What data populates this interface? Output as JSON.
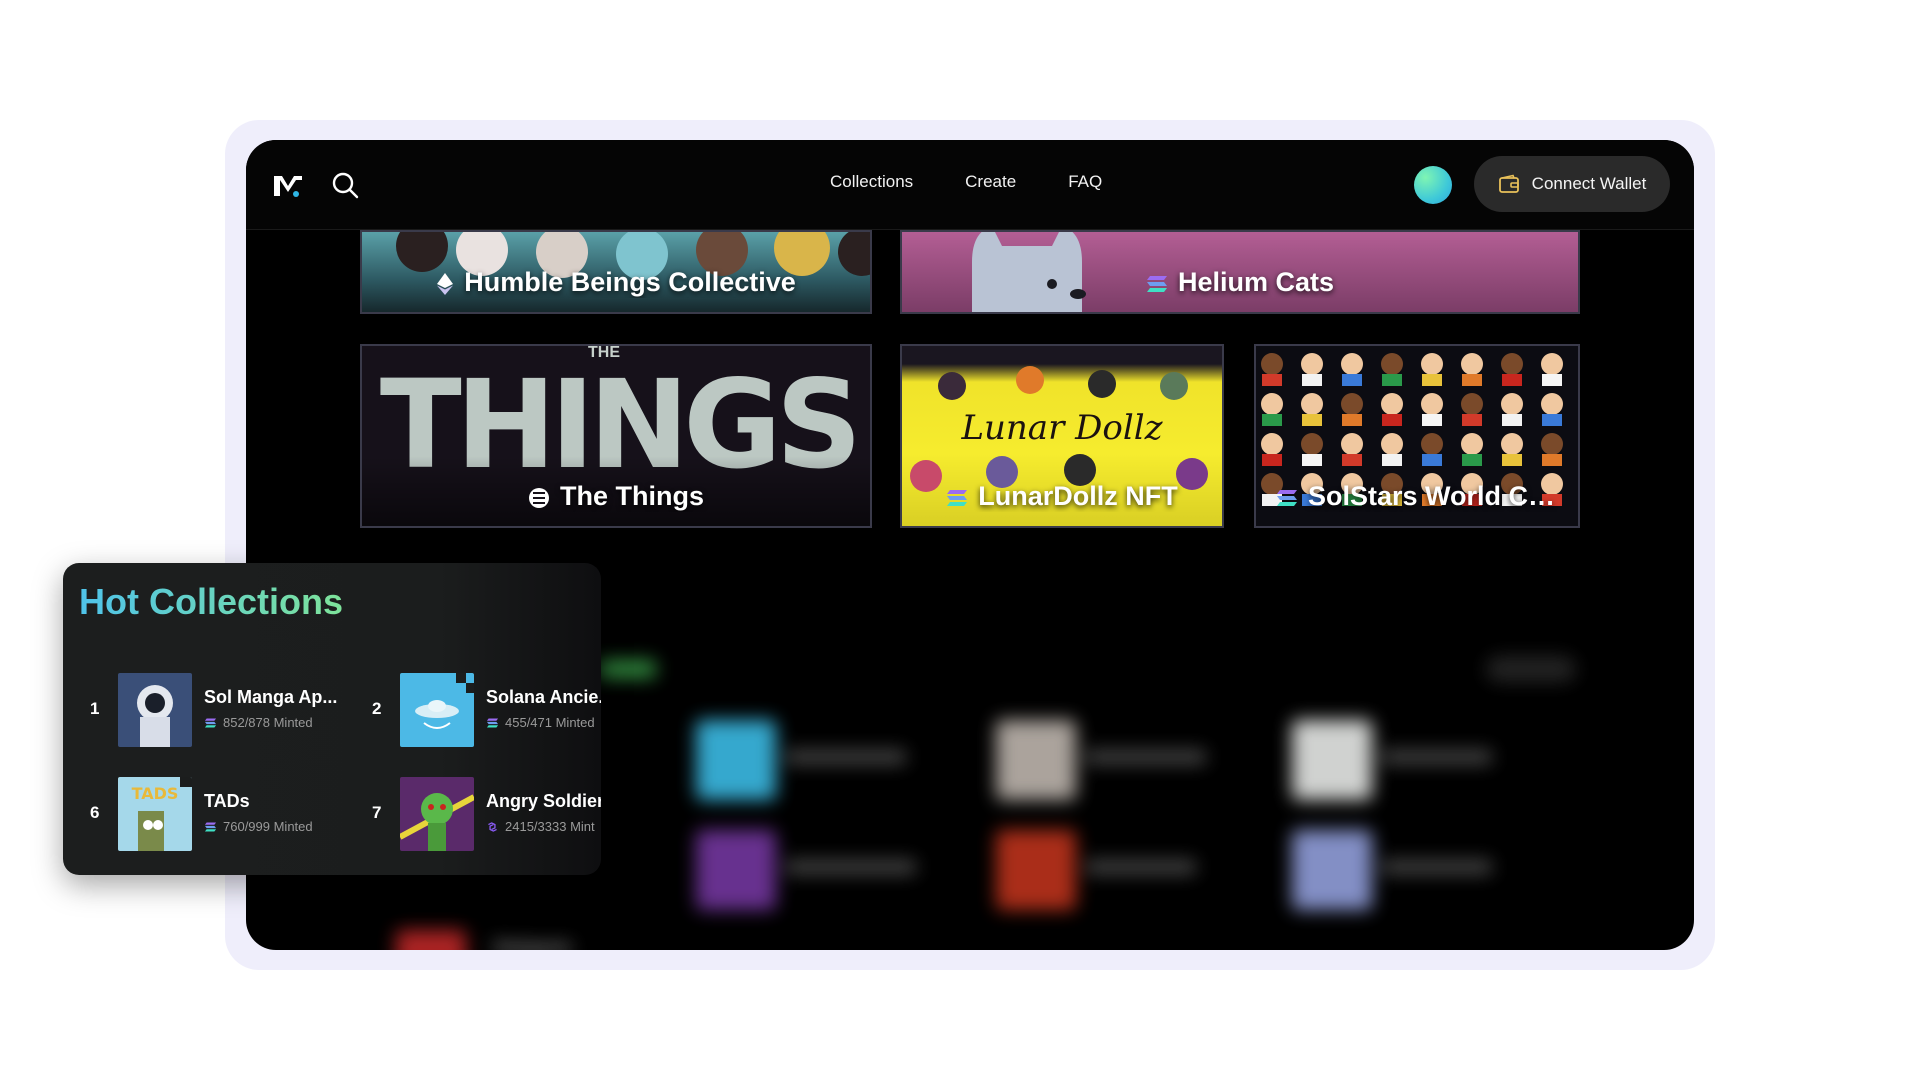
{
  "header": {
    "logo_icon": "magic-eden-logo-icon",
    "search_icon": "search-icon",
    "nav": [
      "Collections",
      "Create",
      "FAQ"
    ],
    "connect_wallet_label": "Connect Wallet",
    "wallet_icon": "wallet-icon"
  },
  "featured": {
    "row1": [
      {
        "name": "Humble Beings Collective",
        "chain": "ethereum"
      },
      {
        "name": "Helium Cats",
        "chain": "solana"
      }
    ],
    "row2": [
      {
        "name": "The Things",
        "chain": "solana",
        "art_text": "THINGS",
        "art_small": "THE"
      },
      {
        "name": "LunarDollz NFT",
        "chain": "solana",
        "art_text": "Lunar Dollz"
      },
      {
        "name": "SolStars World Cu...",
        "chain": "solana"
      }
    ]
  },
  "hot_collections": {
    "title": "Hot Collections",
    "items": [
      {
        "rank": "1",
        "name": "Sol Manga Ap...",
        "minted": "852/878 Minted",
        "chain": "solana"
      },
      {
        "rank": "2",
        "name": "Solana Ancie...",
        "minted": "455/471 Minted",
        "chain": "solana"
      },
      {
        "rank": "6",
        "name": "TADs",
        "minted": "760/999 Minted",
        "chain": "solana",
        "art_text": "TADS"
      },
      {
        "rank": "7",
        "name": "Angry Soldier:",
        "minted": "2415/3333 Mint",
        "chain": "polygon"
      }
    ]
  },
  "background_list": {
    "visible_labels": [
      "Delegram"
    ]
  },
  "colors": {
    "accent_gradient_start": "#4fc3ea",
    "accent_gradient_end": "#7ee39a",
    "frame": "#efeefb",
    "app_bg": "#000000"
  }
}
